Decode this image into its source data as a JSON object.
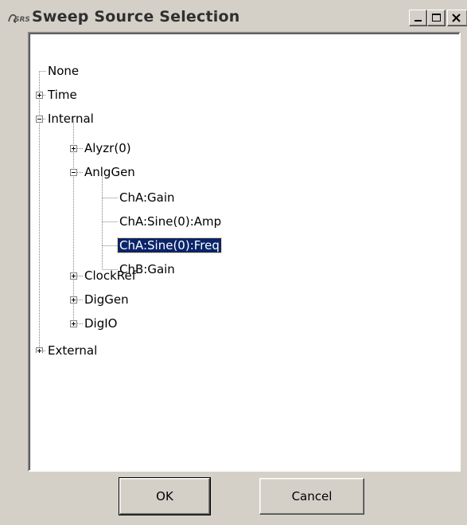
{
  "window": {
    "title": "Sweep Source Selection",
    "icon": "ssrs-app-icon",
    "controls": [
      "minimize-icon",
      "maximize-icon",
      "close-icon"
    ]
  },
  "tree": {
    "nodes": [
      {
        "label": "None",
        "expander": "none"
      },
      {
        "label": "Time",
        "expander": "plus"
      },
      {
        "label": "Internal",
        "expander": "minus"
      },
      {
        "label": "Alyzr(0)",
        "expander": "plus"
      },
      {
        "label": "AnlgGen",
        "expander": "minus"
      },
      {
        "label": "ChA:Gain",
        "expander": "none"
      },
      {
        "label": "ChA:Sine(0):Amp",
        "expander": "none"
      },
      {
        "label": "ChA:Sine(0):Freq",
        "expander": "none",
        "selected": true
      },
      {
        "label": "ChB:Gain",
        "expander": "none"
      },
      {
        "label": "ClockRef",
        "expander": "plus"
      },
      {
        "label": "DigGen",
        "expander": "plus"
      },
      {
        "label": "DigIO",
        "expander": "plus"
      },
      {
        "label": "External",
        "expander": "plus"
      }
    ]
  },
  "buttons": {
    "ok_label": "OK",
    "cancel_label": "Cancel"
  },
  "colors": {
    "face": "#d4d0c8",
    "selection": "#0a246a",
    "tree_bg": "#ffffff"
  }
}
